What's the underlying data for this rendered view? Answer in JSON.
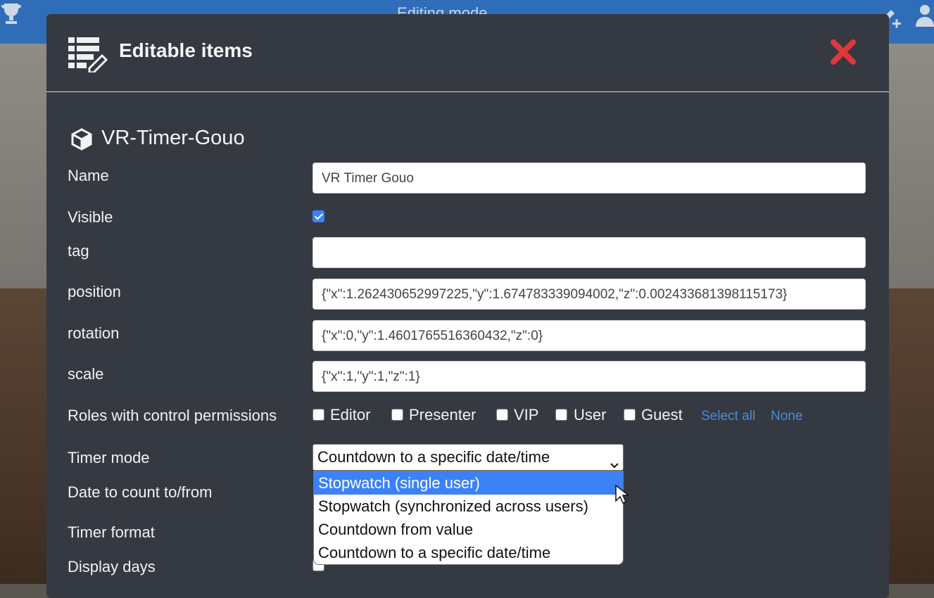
{
  "background": {
    "title": "Editing mode",
    "accent": "#2f6db8",
    "icons": [
      "trophy-icon",
      "edit-add-icon",
      "users-icon"
    ]
  },
  "modal": {
    "title": "Editable items",
    "close_icon": "close-x-icon",
    "close_color": "#e0373a",
    "item_title": "VR-Timer-Gouo",
    "fields": {
      "name": {
        "label": "Name",
        "value": "VR Timer Gouo"
      },
      "visible": {
        "label": "Visible",
        "checked": true
      },
      "tag": {
        "label": "tag",
        "value": ""
      },
      "position": {
        "label": "position",
        "value": "{\"x\":1.262430652997225,\"y\":1.674783339094002,\"z\":0.002433681398115173}"
      },
      "rotation": {
        "label": "rotation",
        "value": "{\"x\":0,\"y\":1.4601765516360432,\"z\":0}"
      },
      "scale": {
        "label": "scale",
        "value": "{\"x\":1,\"y\":1,\"z\":1}"
      },
      "roles": {
        "label": "Roles with control permissions",
        "options": [
          "Editor",
          "Presenter",
          "VIP",
          "User",
          "Guest"
        ],
        "select_all": "Select all",
        "none": "None"
      },
      "timer_mode": {
        "label": "Timer mode",
        "selected": "Countdown to a specific date/time",
        "options": [
          "Stopwatch (single user)",
          "Stopwatch (synchronized across users)",
          "Countdown from value",
          "Countdown to a specific date/time"
        ],
        "highlighted_index": 0
      },
      "date": {
        "label": "Date to count to/from"
      },
      "timer_format": {
        "label": "Timer format"
      },
      "display_days": {
        "label": "Display days"
      }
    },
    "selection_color": "#3b82f6"
  }
}
